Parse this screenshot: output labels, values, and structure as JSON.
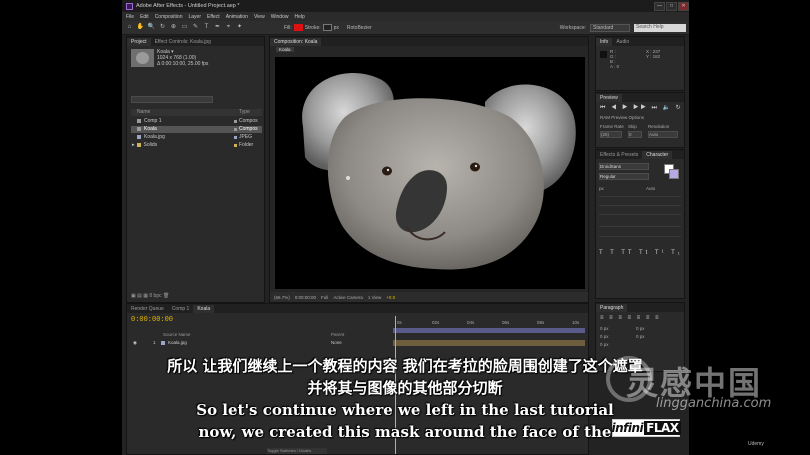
{
  "window": {
    "title": "Adobe After Effects - Untitled Project.aep *",
    "controls": [
      "—",
      "□",
      "✕"
    ]
  },
  "menu": [
    "File",
    "Edit",
    "Composition",
    "Layer",
    "Effect",
    "Animation",
    "View",
    "Window",
    "Help"
  ],
  "toolbar": {
    "tools": [
      "⌂",
      "✋",
      "🔍",
      "↻",
      "⊕",
      "▭",
      "✎",
      "T",
      "✒",
      "⌖",
      "✦"
    ],
    "fill_label": "Fill:",
    "stroke_label": "Stroke:",
    "stroke_px": "px",
    "autobezier": "RotoBezier",
    "workspace_label": "Workspace:",
    "workspace_value": "Standard",
    "search_placeholder": "Search Help"
  },
  "project": {
    "tabs": [
      "Project",
      "Effect Controls: Koala.jpg"
    ],
    "selected_name": "Koala ▾",
    "selected_info": [
      "1024 x 768 (1.00)",
      "Δ 0:00:10:00, 25.00 fps"
    ],
    "columns": [
      "Name",
      "Type"
    ],
    "items": [
      {
        "name": "Comp 1",
        "type": "Compos",
        "color": "#9a9a9a"
      },
      {
        "name": "Koala",
        "type": "Compos",
        "color": "#9a9a9a",
        "selected": true
      },
      {
        "name": "Koala.jpg",
        "type": "JPEG",
        "color": "#9aa7c4"
      },
      {
        "name": "Solids",
        "type": "Folder",
        "color": "#d0b257"
      }
    ],
    "footer": "8 bpc"
  },
  "comp": {
    "tab": "Composition: Koala",
    "sub_tab": "Koala",
    "footer": [
      "(66.7%)",
      "0:00:00:00",
      "Full",
      "Active Camera",
      "1 View",
      "+0.0"
    ]
  },
  "info": {
    "tabs": [
      "Info",
      "Audio"
    ],
    "lines": [
      "R :",
      "G :",
      "B :",
      "A : 0"
    ],
    "xy": [
      "X : 237",
      "Y : 182"
    ]
  },
  "preview": {
    "tabs": [
      "Preview"
    ],
    "options": "RAM Preview Options",
    "labels": [
      "Frame Rate",
      "Skip",
      "Resolution"
    ],
    "values": [
      "(25)",
      "0",
      "Auto"
    ]
  },
  "character": {
    "tabs": [
      "Effects & Presets",
      "Character"
    ],
    "font": "DroidSans",
    "style": "Regular",
    "size_label": "px",
    "tracking": "Auto"
  },
  "paragraph": {
    "tabs": [
      "Paragraph"
    ],
    "values": [
      "0 px",
      "0 px",
      "0 px",
      "0 px",
      "0 px"
    ]
  },
  "timeline": {
    "tabs": [
      "Render Queue",
      "Comp 1",
      "Koala"
    ],
    "timecode": "0:00:00:00",
    "columns": [
      "Source Name",
      "Parent"
    ],
    "layer": {
      "index": "1",
      "name": "Koala.jpg",
      "parent": "None"
    },
    "ruler": [
      "0s",
      "02s",
      "04s",
      "06s",
      "08s",
      "10s"
    ],
    "footer": "Toggle Switches / Modes"
  },
  "subtitles": {
    "cn_line1": "所以 让我们继续上一个教程的内容 我们在考拉的脸周围创建了这个遮罩",
    "cn_line2": "并将其与图像的其他部分切断",
    "en_line1": "So let's continue where we left in the last tutorial",
    "en_line2": "now, we created this mask around the face of the"
  },
  "watermark": {
    "cn": "灵感中国",
    "en": "lingganchina.com"
  },
  "logo": {
    "part1": "infini",
    "part2": "FLAX"
  },
  "udemy": "Udemy"
}
